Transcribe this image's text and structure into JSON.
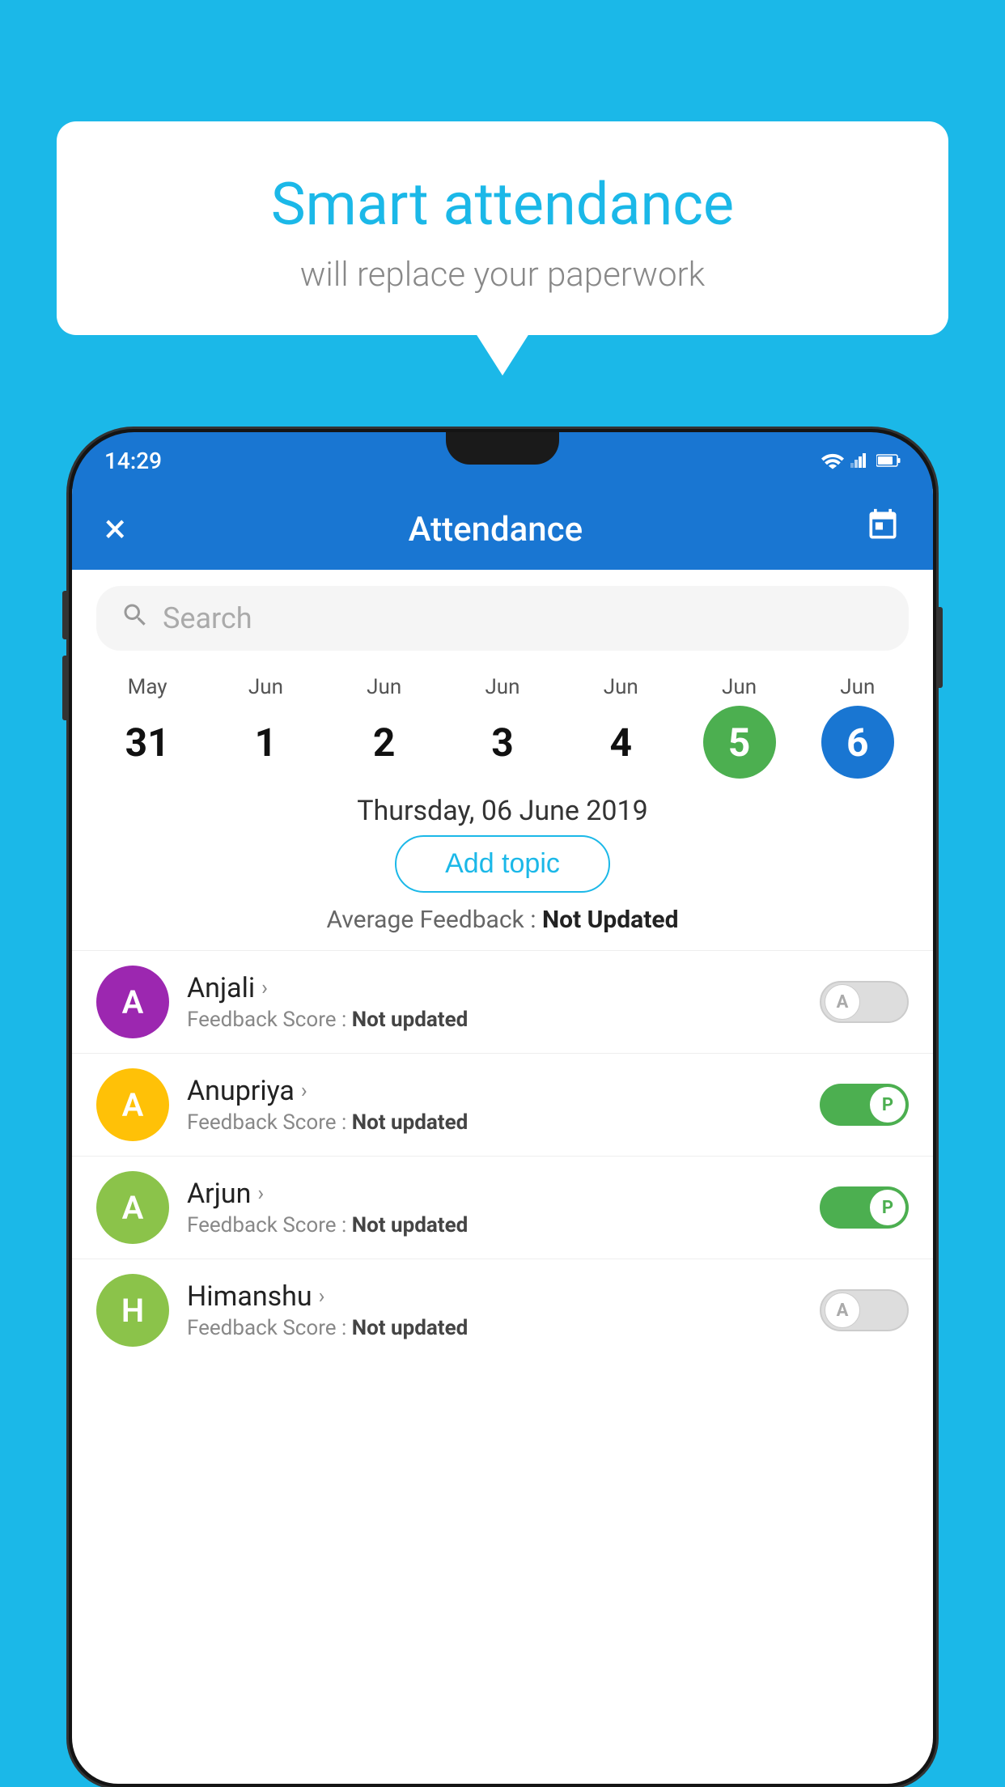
{
  "background_color": "#1BB8E8",
  "speech_bubble": {
    "title": "Smart attendance",
    "subtitle": "will replace your paperwork"
  },
  "status_bar": {
    "time": "14:29"
  },
  "top_bar": {
    "title": "Attendance",
    "close_label": "×",
    "calendar_icon": "calendar-icon"
  },
  "search": {
    "placeholder": "Search"
  },
  "calendar": {
    "days": [
      {
        "month": "May",
        "num": "31",
        "state": "normal"
      },
      {
        "month": "Jun",
        "num": "1",
        "state": "normal"
      },
      {
        "month": "Jun",
        "num": "2",
        "state": "normal"
      },
      {
        "month": "Jun",
        "num": "3",
        "state": "normal"
      },
      {
        "month": "Jun",
        "num": "4",
        "state": "normal"
      },
      {
        "month": "Jun",
        "num": "5",
        "state": "today"
      },
      {
        "month": "Jun",
        "num": "6",
        "state": "selected"
      }
    ]
  },
  "selected_date": "Thursday, 06 June 2019",
  "add_topic_label": "Add topic",
  "avg_feedback_label": "Average Feedback :",
  "avg_feedback_value": "Not Updated",
  "students": [
    {
      "name": "Anjali",
      "avatar_letter": "A",
      "avatar_color": "#9C27B0",
      "feedback_label": "Feedback Score :",
      "feedback_value": "Not updated",
      "toggle": "off",
      "toggle_letter": "A"
    },
    {
      "name": "Anupriya",
      "avatar_letter": "A",
      "avatar_color": "#FFC107",
      "feedback_label": "Feedback Score :",
      "feedback_value": "Not updated",
      "toggle": "on",
      "toggle_letter": "P"
    },
    {
      "name": "Arjun",
      "avatar_letter": "A",
      "avatar_color": "#8BC34A",
      "feedback_label": "Feedback Score :",
      "feedback_value": "Not updated",
      "toggle": "on",
      "toggle_letter": "P"
    },
    {
      "name": "Himanshu",
      "avatar_letter": "H",
      "avatar_color": "#8BC34A",
      "feedback_label": "Feedback Score :",
      "feedback_value": "Not updated",
      "toggle": "off",
      "toggle_letter": "A"
    }
  ]
}
